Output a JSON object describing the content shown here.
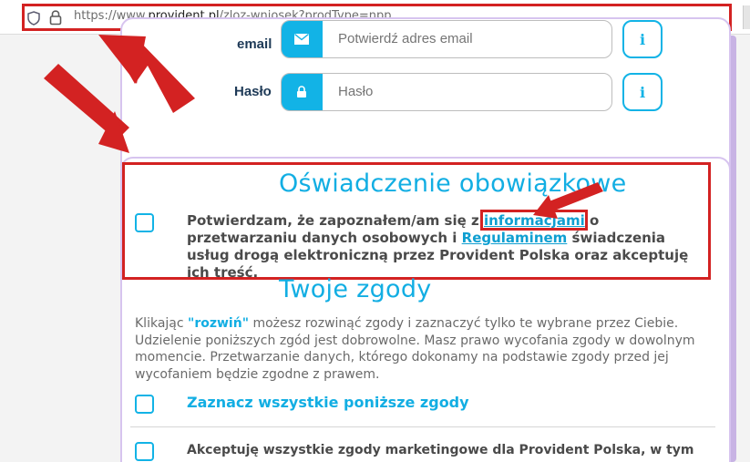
{
  "browser": {
    "url_prefix": "https://www.",
    "url_domain": "provident.pl",
    "url_suffix": "/zloz-wniosek?prodType=npp"
  },
  "login": {
    "email_label": "email",
    "email_placeholder": "Potwierdź adres email",
    "password_label": "Hasło",
    "password_placeholder": "Hasło",
    "info_glyph": "i"
  },
  "declaration": {
    "title": "Oświadczenie obowiązkowe",
    "text_1": "Potwierdzam, że zapoznałem/am się z ",
    "link_information": "informacjami",
    "text_2": " o przetwarzaniu danych osobowych i ",
    "link_regulations": "Regulaminem",
    "text_3": " świadczenia usług drogą elektroniczną przez Provident Polska oraz akceptuję ich treść."
  },
  "consents": {
    "title": "Twoje zgody",
    "intro_1": "Klikając ",
    "intro_expand": "\"rozwiń\"",
    "intro_2": " możesz rozwinąć zgody i zaznaczyć tylko te wybrane przez Ciebie. Udzielenie poniższych zgód jest dobrowolne. Masz prawo wycofania zgody w dowolnym momencie. Przetwarzanie danych, którego dokonamy na podstawie zgody przed jej wycofaniem będzie zgodne z prawem.",
    "select_all_label": "Zaznacz wszystkie poniższe zgody",
    "marketing_label": "Akceptuję wszystkie zgody marketingowe dla Provident Polska, w tym"
  },
  "colors": {
    "accent": "#12b3e6",
    "annotation_red": "#d32222",
    "card_border": "#d7c4ef"
  }
}
